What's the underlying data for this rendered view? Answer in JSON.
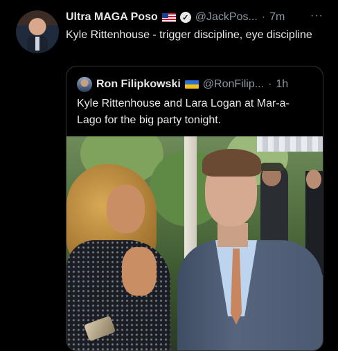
{
  "tweet": {
    "author_name": "Ultra MAGA Poso",
    "handle": "@JackPos...",
    "separator": "·",
    "time": "7m",
    "more": "···",
    "text": "Kyle Rittenhouse - trigger discipline, eye discipline"
  },
  "quoted_tweet": {
    "author_name": "Ron Filipkowski",
    "handle": "@RonFilip...",
    "separator": "·",
    "time": "1h",
    "text": "Kyle Rittenhouse and Lara Logan at Mar-a-Lago for the big party tonight."
  },
  "icons": {
    "us_flag": "us-flag-icon",
    "ukraine_flag": "ukraine-flag-icon",
    "verified": "verified-badge-icon",
    "more": "more-icon"
  },
  "colors": {
    "background": "#000000",
    "text": "#e7e9ea",
    "muted": "#8b98a5",
    "border": "#2f3336"
  }
}
